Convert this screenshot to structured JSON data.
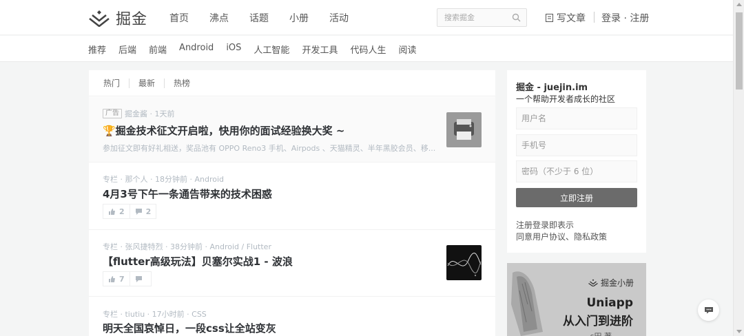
{
  "header": {
    "logo_text": "掘金",
    "nav": [
      "首页",
      "沸点",
      "话题",
      "小册",
      "活动"
    ],
    "search_placeholder": "搜索掘金",
    "write_label": "写文章",
    "auth_label": "登录 · 注册"
  },
  "subnav": [
    "推荐",
    "后端",
    "前端",
    "Android",
    "iOS",
    "人工智能",
    "开发工具",
    "代码人生",
    "阅读"
  ],
  "feed": {
    "tabs": [
      "热门",
      "最新",
      "热榜"
    ],
    "entries": [
      {
        "tag": "广告",
        "meta": "掘金酱 · 1天前",
        "title": "🏆掘金技术征文开启啦，快用你的面试经验换大奖 ~",
        "desc": "参加征文即有好礼相送，奖品池有 OPPO Reno3 手机、Airpods 、天猫精灵、半年黑胶会员、移..."
      },
      {
        "meta": "专栏 · 那个人 · 18分钟前 · Android",
        "title": "4月3号下午一条通告带来的技术困惑",
        "likes": "2",
        "comments": "2"
      },
      {
        "meta": "专栏 · 张风捷特烈 · 38分钟前 · Android / Flutter",
        "title": "【flutter高级玩法】贝塞尔实战1 - 波浪",
        "likes": "7",
        "comments": ""
      },
      {
        "meta": "专栏 · tiutiu · 17小时前 · CSS",
        "title": "明天全国哀悼日，一段css让全站变灰"
      }
    ]
  },
  "signup": {
    "title": "掘金 - juejin.im",
    "subtitle": "一个帮助开发者成长的社区",
    "username_placeholder": "用户名",
    "phone_placeholder": "手机号",
    "password_placeholder": "密码（不少于 6 位）",
    "button": "立即注册",
    "terms_line1": "注册登录即表示",
    "terms_line2": "同意用户协议、隐私政策"
  },
  "banner": {
    "brand": "掘金小册",
    "title": "Uniapp",
    "subtitle": "从入门到进阶",
    "author": "ѕ田 著"
  }
}
